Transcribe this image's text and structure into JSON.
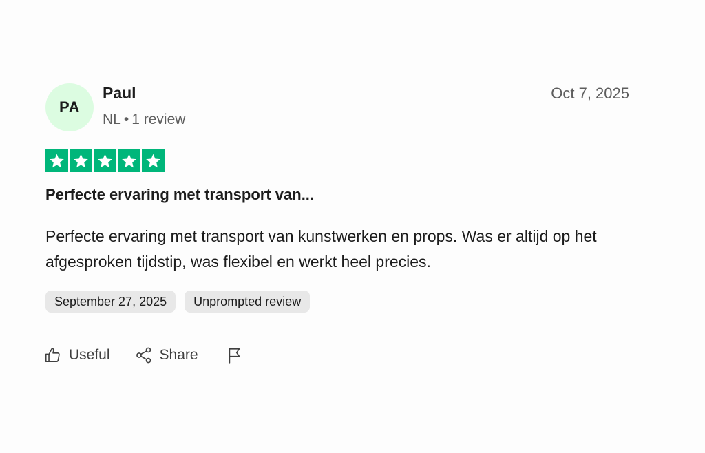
{
  "reviewer": {
    "initials": "PA",
    "name": "Paul",
    "country": "NL",
    "separator": "•",
    "review_count": "1 review"
  },
  "review": {
    "date": "Oct 7, 2025",
    "rating": 5,
    "rating_max": 5,
    "title": "Perfecte ervaring met transport van...",
    "body": "Perfecte ervaring met transport van kunstwerken en props. Was er altijd op het afgesproken tijdstip, was flexibel en werkt heel precies.",
    "tags": {
      "experience_date": "September 27, 2025",
      "type": "Unprompted review"
    }
  },
  "actions": {
    "useful_label": "Useful",
    "share_label": "Share"
  },
  "icons": {
    "star": "star-icon",
    "useful": "thumbs-up-icon",
    "share": "share-icon",
    "flag": "flag-icon"
  },
  "colors": {
    "star_green": "#00b67a",
    "avatar_bg": "#dcfce1",
    "tag_bg": "#e8e8e8",
    "muted_text": "#5d5d5d"
  }
}
